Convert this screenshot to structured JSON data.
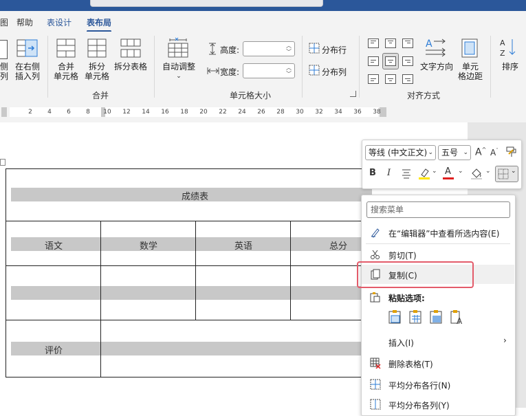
{
  "titlebar": {},
  "tabs": [
    {
      "label": "图"
    },
    {
      "label": "帮助"
    },
    {
      "label": "表设计"
    },
    {
      "label": "表布局"
    }
  ],
  "ribbon": {
    "insert_left": {
      "line1": "侧",
      "line2": "列"
    },
    "insert_right": {
      "line1": "在右侧",
      "line2": "插入列"
    },
    "merge_cells": {
      "line1": "合并",
      "line2": "单元格"
    },
    "split_cells": {
      "line1": "拆分",
      "line2": "单元格"
    },
    "split_table": {
      "label": "拆分表格"
    },
    "group_merge": "合并",
    "autofit": {
      "label": "自动调整"
    },
    "height_label": "高度:",
    "width_label": "宽度:",
    "height_value": "",
    "width_value": "",
    "distribute_rows": "分布行",
    "distribute_cols": "分布列",
    "group_cellsize": "单元格大小",
    "text_direction": "文字方向",
    "cell_margins": {
      "line1": "单元",
      "line2": "格边距"
    },
    "group_align": "对齐方式",
    "sort": "排序"
  },
  "ruler": {
    "numbers": [
      "2",
      "4",
      "6",
      "8",
      "10",
      "12",
      "14",
      "16",
      "18",
      "20",
      "22",
      "24",
      "26",
      "28",
      "30",
      "32",
      "34",
      "36",
      "38"
    ]
  },
  "table": {
    "title": "成绩表",
    "headers": [
      "语文",
      "数学",
      "英语",
      "总分"
    ],
    "eval_label": "评价"
  },
  "mini_toolbar": {
    "font": "等线 (中文正文)",
    "size": "五号",
    "bold": "B",
    "italic": "I",
    "grow": "A",
    "shrink": "A",
    "font_color": "A"
  },
  "context_menu": {
    "search_placeholder": "搜索菜单",
    "items": [
      {
        "label": "在“编辑器”中查看所选内容(E)"
      },
      {
        "label": "剪切(T)"
      },
      {
        "label": "复制(C)"
      },
      {
        "label": "粘贴选项:"
      },
      {
        "label": "插入(I)"
      },
      {
        "label": "删除表格(T)"
      },
      {
        "label": "平均分布各行(N)"
      },
      {
        "label": "平均分布各列(Y)"
      }
    ]
  },
  "colors": {
    "brand_blue": "#2b579a",
    "highlight_red": "#e35b6a",
    "highlighter_yellow": "#ffe600",
    "font_red": "#e02020"
  }
}
